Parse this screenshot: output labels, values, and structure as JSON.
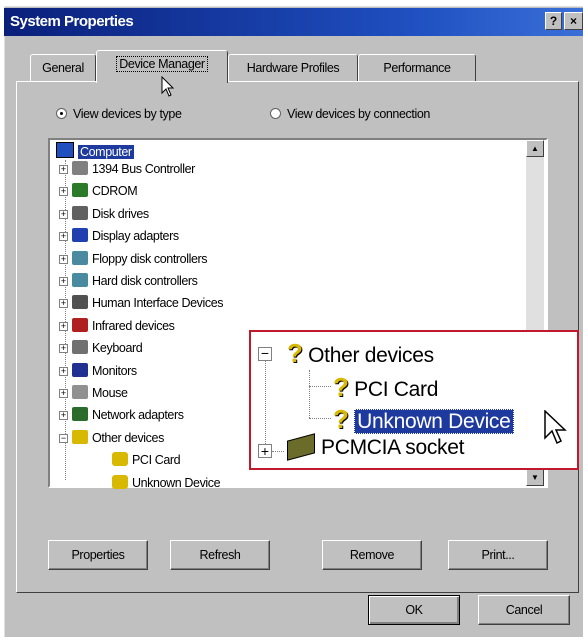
{
  "window": {
    "title": "System Properties",
    "help_btn": "?",
    "close_btn": "×"
  },
  "tabs": [
    {
      "label": "General"
    },
    {
      "label": "Device Manager"
    },
    {
      "label": "Hardware Profiles"
    },
    {
      "label": "Performance"
    }
  ],
  "view_options": {
    "by_type": "View devices by type",
    "by_connection": "View devices by connection"
  },
  "tree": {
    "root": "Computer",
    "items": [
      {
        "label": "1394 Bus Controller",
        "icon": "bus-controller-icon"
      },
      {
        "label": "CDROM",
        "icon": "cdrom-icon"
      },
      {
        "label": "Disk drives",
        "icon": "disk-drive-icon"
      },
      {
        "label": "Display adapters",
        "icon": "display-adapter-icon"
      },
      {
        "label": "Floppy disk controllers",
        "icon": "floppy-controller-icon"
      },
      {
        "label": "Hard disk controllers",
        "icon": "hard-disk-controller-icon"
      },
      {
        "label": "Human Interface Devices",
        "icon": "hid-icon"
      },
      {
        "label": "Infrared devices",
        "icon": "infrared-icon"
      },
      {
        "label": "Keyboard",
        "icon": "keyboard-icon"
      },
      {
        "label": "Monitors",
        "icon": "monitor-icon"
      },
      {
        "label": "Mouse",
        "icon": "mouse-icon"
      },
      {
        "label": "Network adapters",
        "icon": "network-adapter-icon"
      },
      {
        "label": "Other devices",
        "icon": "question-mark-icon"
      }
    ],
    "other_children": [
      {
        "label": "PCI Card",
        "icon": "question-mark-icon"
      },
      {
        "label": "Unknown Device",
        "icon": "question-mark-icon"
      }
    ],
    "last_partial": "PCMCIA socket"
  },
  "zoom_callout": {
    "other_devices": "Other devices",
    "pci_card": "PCI Card",
    "unknown_device": "Unknown Device",
    "pcmcia_socket": "PCMCIA socket"
  },
  "buttons": {
    "properties": "Properties",
    "refresh": "Refresh",
    "remove": "Remove",
    "print": "Print...",
    "ok": "OK",
    "cancel": "Cancel"
  },
  "colors": {
    "titlebar": "#0a1f7a",
    "selection": "#1f3a9e",
    "callout_border": "#c0182c",
    "face": "#c0c0c0"
  }
}
